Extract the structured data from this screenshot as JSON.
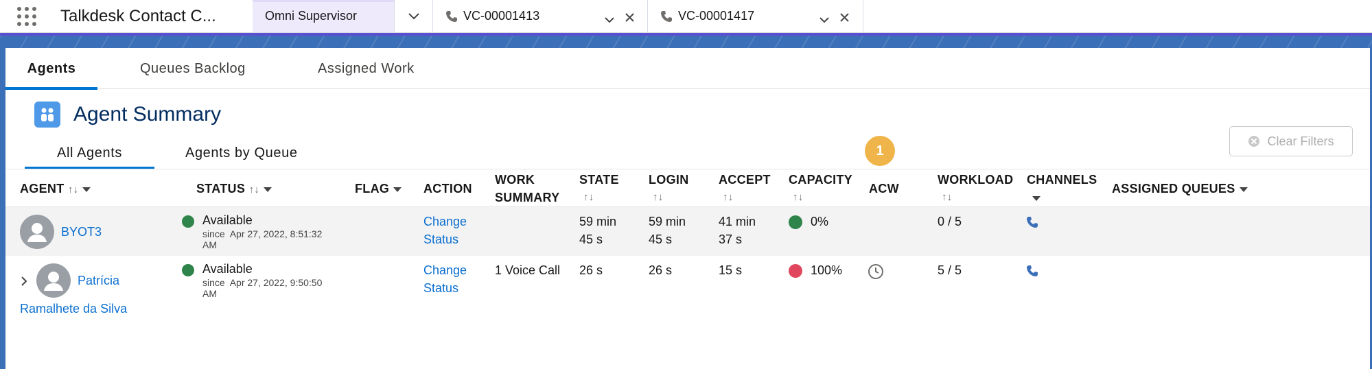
{
  "topbar": {
    "app_name": "Talkdesk Contact C...",
    "tabs": [
      {
        "label": "Omni Supervisor"
      },
      {
        "label": "VC-00001413"
      },
      {
        "label": "VC-00001417"
      }
    ]
  },
  "subtabs": [
    "Agents",
    "Queues Backlog",
    "Assigned Work"
  ],
  "summary": {
    "title": "Agent Summary",
    "tabs": [
      "All Agents",
      "Agents by Queue"
    ],
    "badge": "1",
    "clear_filters": "Clear Filters"
  },
  "columns": {
    "agent": "AGENT",
    "status": "STATUS",
    "flag": "FLAG",
    "action": "ACTION",
    "work_summary_1": "WORK",
    "work_summary_2": "SUMMARY",
    "state": "STATE",
    "login": "LOGIN",
    "accept": "ACCEPT",
    "capacity": "CAPACITY",
    "acw": "ACW",
    "workload": "WORKLOAD",
    "channels": "CHANNELS",
    "assigned_queues": "ASSIGNED QUEUES"
  },
  "rows": [
    {
      "agent": "BYOT3",
      "status": "Available",
      "since_label": "since",
      "since_1": "Apr 27, 2022, 8:51:32",
      "since_2": "AM",
      "action_1": "Change",
      "action_2": "Status",
      "work_summary": "",
      "state_1": "59 min",
      "state_2": "45 s",
      "login_1": "59 min",
      "login_2": "45 s",
      "accept_1": "41 min",
      "accept_2": "37 s",
      "capacity": "0%",
      "capacity_color": "#2e844a",
      "workload": "0 / 5"
    },
    {
      "agent": "Patrícia",
      "agent_line2": "Ramalhete da Silva",
      "status": "Available",
      "since_label": "since",
      "since_1": "Apr 27, 2022, 9:50:50",
      "since_2": "AM",
      "action_1": "Change",
      "action_2": "Status",
      "work_summary": "1 Voice Call",
      "state_1": "26 s",
      "login_1": "26 s",
      "accept_1": "15 s",
      "capacity": "100%",
      "capacity_color": "#e0475e",
      "workload": "5 / 5"
    }
  ],
  "colors": {
    "status_available": "#2e844a",
    "link": "#0b6fd0",
    "brand_banner": "#3b6fb8",
    "badge": "#f0b54a"
  }
}
